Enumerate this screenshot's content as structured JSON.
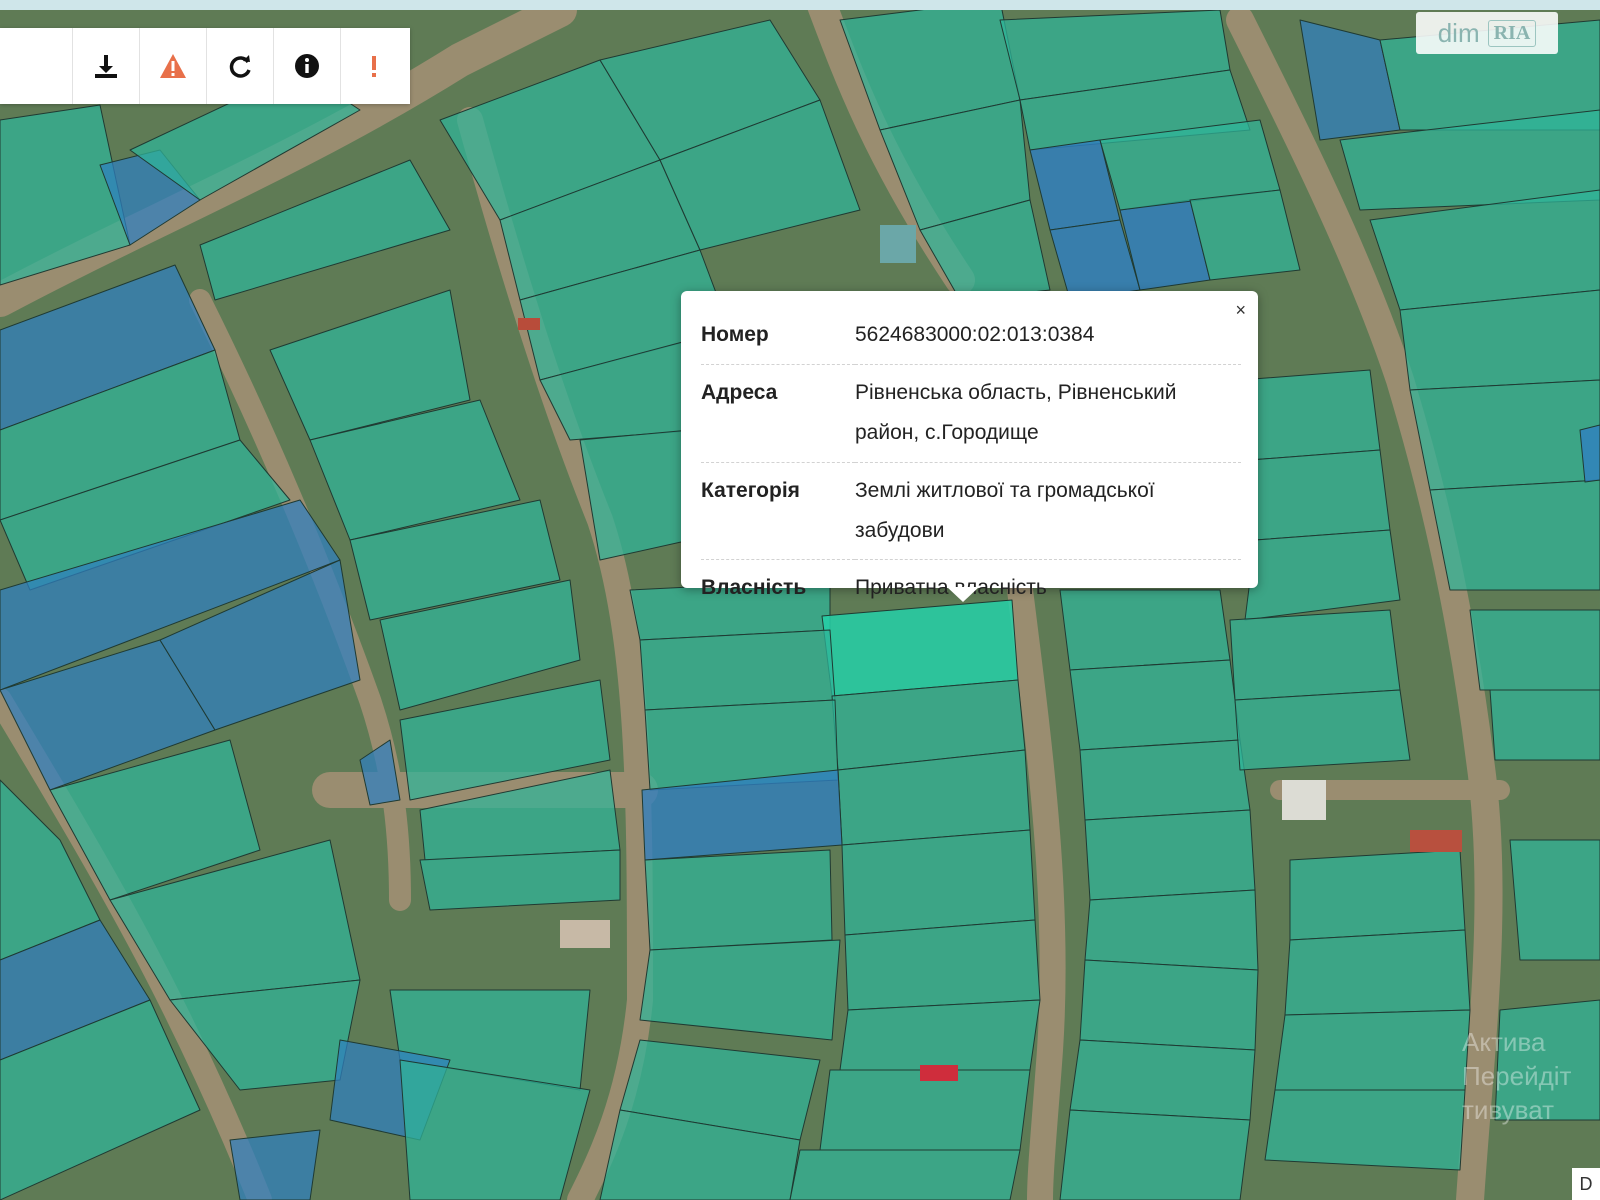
{
  "toolbar": {
    "buttons": [
      {
        "name": "download-icon",
        "glyph": "download",
        "color": "#111111"
      },
      {
        "name": "warning-icon",
        "glyph": "warning",
        "color": "#e8704a"
      },
      {
        "name": "refresh-icon",
        "glyph": "refresh",
        "color": "#111111"
      },
      {
        "name": "info-icon",
        "glyph": "info",
        "color": "#111111"
      },
      {
        "name": "exclamation-icon",
        "glyph": "exclamation",
        "color": "#e8704a"
      }
    ]
  },
  "watermark": {
    "dim": "dim",
    "ria": "RIA"
  },
  "popup": {
    "close": "×",
    "rows": [
      {
        "key": "Номер",
        "value": "5624683000:02:013:0384"
      },
      {
        "key": "Адреса",
        "value": "Рівненська область, Рівненський район, с.Городище"
      },
      {
        "key": "Категорія",
        "value": "Землі житлової та громадської забудови"
      },
      {
        "key": "Власність",
        "value": "Приватна власність"
      }
    ]
  },
  "attribution": "D",
  "activate_overlay": [
    "Актива",
    "Перейдіт",
    "тивуват"
  ],
  "colors": {
    "parcel_green": "#2fb59a",
    "parcel_blue": "#2f7fc0",
    "selected_parcel": "#25d0a8",
    "road": "#8a7f66"
  }
}
